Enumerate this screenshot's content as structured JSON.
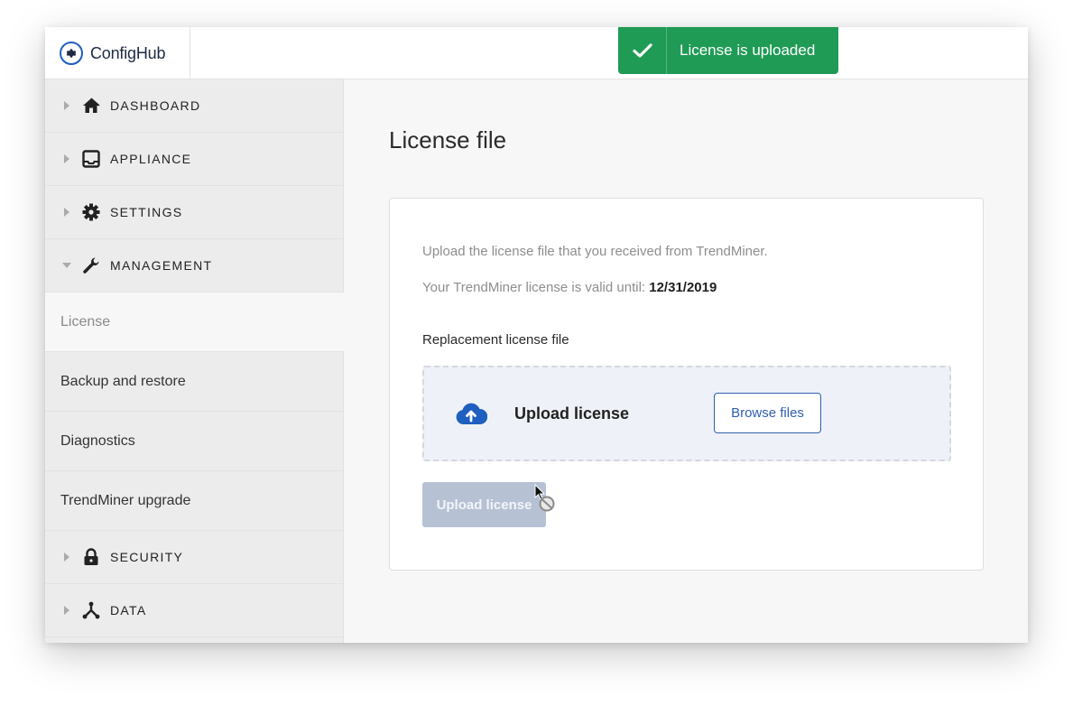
{
  "app": {
    "name": "ConfigHub"
  },
  "toast": {
    "message": "License is uploaded",
    "color": "#1f9b55"
  },
  "sidebar": {
    "groups_top": [
      {
        "label": "DASHBOARD",
        "icon": "home-icon"
      },
      {
        "label": "APPLIANCE",
        "icon": "inbox-icon"
      },
      {
        "label": "SETTINGS",
        "icon": "gear-icon"
      },
      {
        "label": "MANAGEMENT",
        "icon": "wrench-icon",
        "expanded": true
      }
    ],
    "management_items": [
      {
        "label": "License",
        "active": true
      },
      {
        "label": "Backup and restore"
      },
      {
        "label": "Diagnostics"
      },
      {
        "label": "TrendMiner upgrade"
      }
    ],
    "groups_bottom": [
      {
        "label": "SECURITY",
        "icon": "lock-icon"
      },
      {
        "label": "DATA",
        "icon": "share-icon"
      }
    ]
  },
  "main": {
    "title": "License file",
    "description": "Upload the license file that you received from TrendMiner.",
    "valid_prefix": "Your TrendMiner license is valid until:",
    "valid_date": "12/31/2019",
    "field_label": "Replacement license file",
    "dropzone_title": "Upload license",
    "browse_label": "Browse files",
    "upload_button_label": "Upload license",
    "upload_button_disabled": true
  },
  "colors": {
    "accent": "#2f5fb0",
    "disabled_button": "#b6c1d4",
    "sidebar_bg": "#ececec"
  }
}
